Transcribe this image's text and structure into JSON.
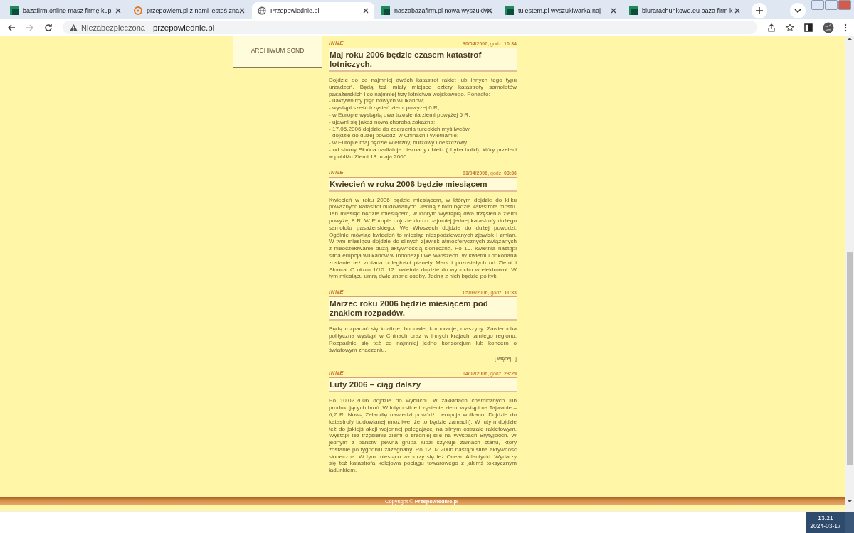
{
  "browser": {
    "tabs": [
      {
        "title": "bazafirm.online masz firmę kup",
        "kind": "square",
        "selected": false
      },
      {
        "title": "przepowiem.pl z nami jesteś zna",
        "kind": "swirl",
        "selected": false
      },
      {
        "title": "Przepowiednie.pl",
        "kind": "globe",
        "selected": true
      },
      {
        "title": "naszabazafirm.pl nowa wyszukiw",
        "kind": "square",
        "selected": false
      },
      {
        "title": "tujestem.pl wyszukiwarka naj",
        "kind": "square",
        "selected": false
      },
      {
        "title": "biurarachunkowe.eu baza firm k",
        "kind": "square",
        "selected": false
      }
    ],
    "security_label": "Niezabezpieczona",
    "url": "przepowiednie.pl"
  },
  "sidebar": {
    "items": [
      "ARCHIWUM SOND"
    ]
  },
  "articles": [
    {
      "category": "INNE",
      "date": "**30/04/2006**, godz. **10:34**",
      "title": "Maj roku 2006 będzie czasem katastrof lotniczych.",
      "body": [
        "Dojdzie do co najmniej dwóch katastrof rakiet lub innych tego typu urządzeń. Będą też miały miejsce cztery katastrofy samolotów pasażerskich i co najmniej trzy lotnictwa wojskowego. Ponadto:",
        "- uaktywnimy pięć nowych wulkanów;",
        "- wystąpi sześć trzęsień ziemi powyżej 6 R;",
        "- w Europie wystąpią dwa trzęsienia ziemi powyżej 5 R;",
        "- ujawni się jakaś nowa choroba zakaźna;",
        "- 17.05.2006 dojdzie do zderzenia tureckich myśliwców;",
        "- dojdzie do dużej powodzi w Chinach i Wietnamie;",
        "- w Europie maj będzie wietrzny, burzowy i deszczowy;",
        "- od strony Słońca nadlatuje nieznany obiekt (chyba bolid), który przeleci w pobliżu Ziemi 18. maja 2006."
      ]
    },
    {
      "category": "INNE",
      "date": "**01/04/2006**, godz. **03:36**",
      "title": "Kwiecień w roku 2006 będzie miesiącem",
      "body": [
        "Kwiecień w roku 2006 będzie miesiącem, w którym dojdzie do kilku poważnych katastrof budowlanych. Jedną z nich będzie katastrofa mostu. Ten miesiąc będzie miesiącem, w którym wystąpią dwa trzęsienia ziemi powyżej 8 R. W Europie dojdzie do co najmniej jednej katastrofy dużego samolotu pasażerskiego. We Włoszech dojdzie do dużej powodzi. Ogólnie mówiąc kwiecień to miesiąc niespodziewanych zjawisk i zmian. W tym miesiącu dojdzie do silnych zjawisk atmosferycznych związanych z nieoczekiwanie dużą aktywnością słoneczną. Po 10. kwietnia nastąpi silna erupcja wulkanów w Indonezji i we Włoszech. W kwietniu dokonana zostanie też zmiana odległości planety Mars i pozostałych od Ziemi i Słońca. O około 1/10. 12. kwietnia dojdzie do wybuchu w elektrowni. W tym miesiącu umrą dwie znane osoby. Jedną z nich będzie polityk."
      ]
    },
    {
      "category": "INNE",
      "date": "**05/03/2006**, godz. **11:33**",
      "title": "Marzec roku 2006 będzie miesiącem pod znakiem rozpadów.",
      "body": [
        "Będą rozpadać się koalicje, budowle, korporacje, maszyny. Zawierucha polityczna wystąpi w Chinach oraz w innych krajach tamtego regionu. Rozpadnie się też co najmniej jedno konsorcjum lub koncern o światowym znaczeniu."
      ],
      "more": "[ więcej.. ]"
    },
    {
      "category": "INNE",
      "date": "**04/02/2006**, godz. **23:29**",
      "title": "Luty 2006 – ciąg dalszy",
      "body": [
        "Po 10.02.2006 dojdzie do wybuchu w zakładach chemicznych lub produkujących broń. W lutym silne trzęsienie ziemi wystąpi na Tajwanie – 6,7 R. Nową Zelandię nawiedzi powódź i erupcja wulkanu. Dojdzie do katastrofy budowlanej (możliwe, że to będzie zamach). W lutym dojdzie też do jakiejś akcji wojennej polegającej na silnym ostrzale rakietowym. Wystąpi też trzęsienie ziemi o średniej sile na Wyspach Brytyjskich. W jednym z państw pewna grupa ludzi szykuje zamach stanu, który zostanie po tygodniu zażegnany. Po 12.02.2006 nastąpi silna aktywność słoneczna. W tym miesiącu wzburzy się też Ocean Atlantycki. Wydarzy się też katastrofa kolejowa pociągu towarowego z jakimś toksycznym ładunkiem."
      ]
    }
  ],
  "footer": {
    "copyright": "Copyright © **Przepowiednie.pl**"
  },
  "taskbar": {
    "time": "13:21",
    "date": "2024-03-17"
  }
}
